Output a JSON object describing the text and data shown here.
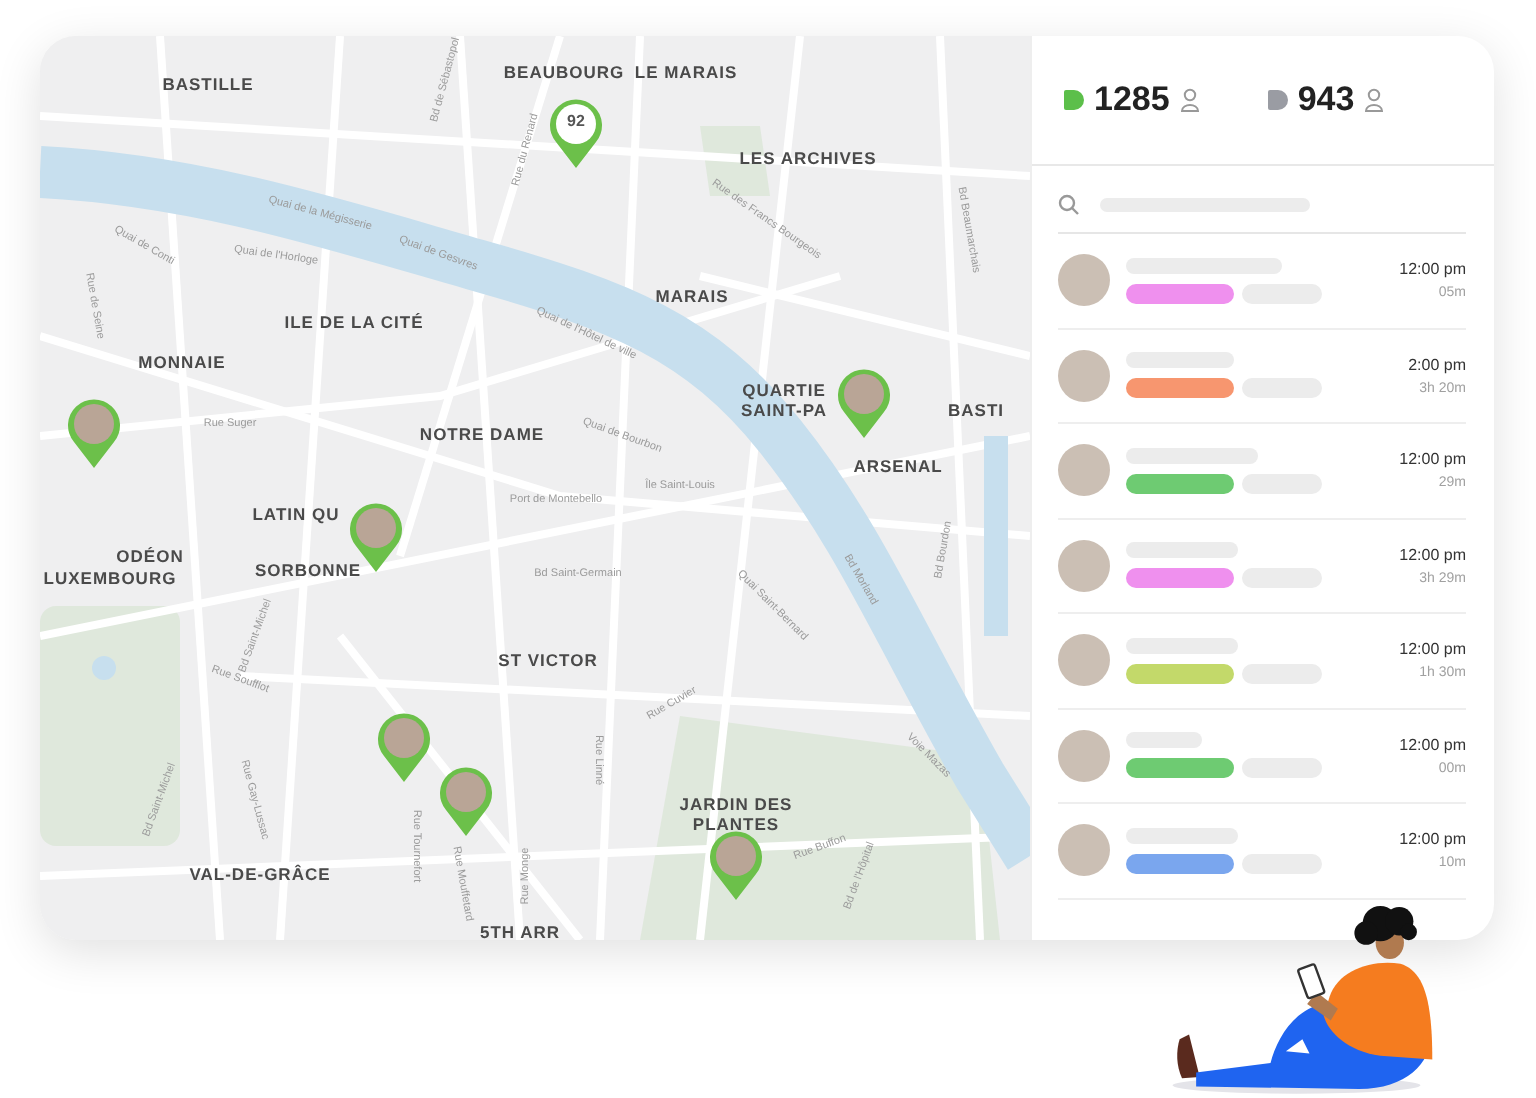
{
  "map": {
    "districts": [
      {
        "text": "BASTILLE"
      },
      {
        "text": "BEAUBOURG"
      },
      {
        "text": "LE MARAIS"
      },
      {
        "text": "LES ARCHIVES"
      },
      {
        "text": "ILE DE LA CITÉ"
      },
      {
        "text": "MARAIS"
      },
      {
        "text": "MONNAIE"
      },
      {
        "text": "NOTRE DAME"
      },
      {
        "text": "QUARTIE SAINT-PA"
      },
      {
        "text": "BASTI"
      },
      {
        "text": "ARSENAL"
      },
      {
        "text": "LATIN QU"
      },
      {
        "text": "ODÉON"
      },
      {
        "text": "LUXEMBOURG"
      },
      {
        "text": "SORBONNE"
      },
      {
        "text": "ST VICTOR"
      },
      {
        "text": "JARDIN DES PLANTES"
      },
      {
        "text": "VAL-DE-GRÂCE"
      },
      {
        "text": "5TH ARR"
      }
    ],
    "streets": [
      {
        "text": "Bd de Sébastopol"
      },
      {
        "text": "Rue du Renard"
      },
      {
        "text": "Quai de la Mégisserie"
      },
      {
        "text": "Quai de Conti"
      },
      {
        "text": "Quai de l'Horloge"
      },
      {
        "text": "Quai de Gesvres"
      },
      {
        "text": "Rue de Seine"
      },
      {
        "text": "Rue Suger"
      },
      {
        "text": "Rue des Francs Bourgeois"
      },
      {
        "text": "Quai de l'Hôtel de ville"
      },
      {
        "text": "Quai de Bourbon"
      },
      {
        "text": "Île Saint-Louis"
      },
      {
        "text": "Port de Montebello"
      },
      {
        "text": "Bd Beaumarchais"
      },
      {
        "text": "Bd Saint-Germain"
      },
      {
        "text": "Bd Saint-Michel"
      },
      {
        "text": "Bd Saint-Michel"
      },
      {
        "text": "Rue Gay-Lussac"
      },
      {
        "text": "Rue Soufflot"
      },
      {
        "text": "Rue Linné"
      },
      {
        "text": "Quai Saint-Bernard"
      },
      {
        "text": "Rue Cuvier"
      },
      {
        "text": "Rue Buffon"
      },
      {
        "text": "Bd de l'Hôpital"
      },
      {
        "text": "Voie Mazas"
      },
      {
        "text": "Bd Morland"
      },
      {
        "text": "Bd Bourdon"
      },
      {
        "text": "Rue Mouffetard"
      },
      {
        "text": "Rue Tournefort"
      },
      {
        "text": "Rue Monge"
      }
    ],
    "pins": [
      {
        "kind": "count",
        "label": "92"
      },
      {
        "kind": "avatar"
      },
      {
        "kind": "avatar"
      },
      {
        "kind": "avatar"
      },
      {
        "kind": "avatar"
      },
      {
        "kind": "avatar"
      },
      {
        "kind": "avatar"
      }
    ]
  },
  "panel": {
    "stats": [
      {
        "value": "1285",
        "color": "#5cbf4a"
      },
      {
        "value": "943",
        "color": "#9a9ca3"
      }
    ],
    "rows": [
      {
        "time": "12:00 pm",
        "duration": "05m",
        "color": "#ef90ee"
      },
      {
        "time": "2:00 pm",
        "duration": "3h 20m",
        "color": "#f7966f"
      },
      {
        "time": "12:00 pm",
        "duration": "29m",
        "color": "#6ecb72"
      },
      {
        "time": "12:00 pm",
        "duration": "3h 29m",
        "color": "#ef90ee"
      },
      {
        "time": "12:00 pm",
        "duration": "1h 30m",
        "color": "#c3d96a"
      },
      {
        "time": "12:00 pm",
        "duration": "00m",
        "color": "#6ecb72"
      },
      {
        "time": "12:00 pm",
        "duration": "10m",
        "color": "#7aa6ee"
      }
    ]
  }
}
